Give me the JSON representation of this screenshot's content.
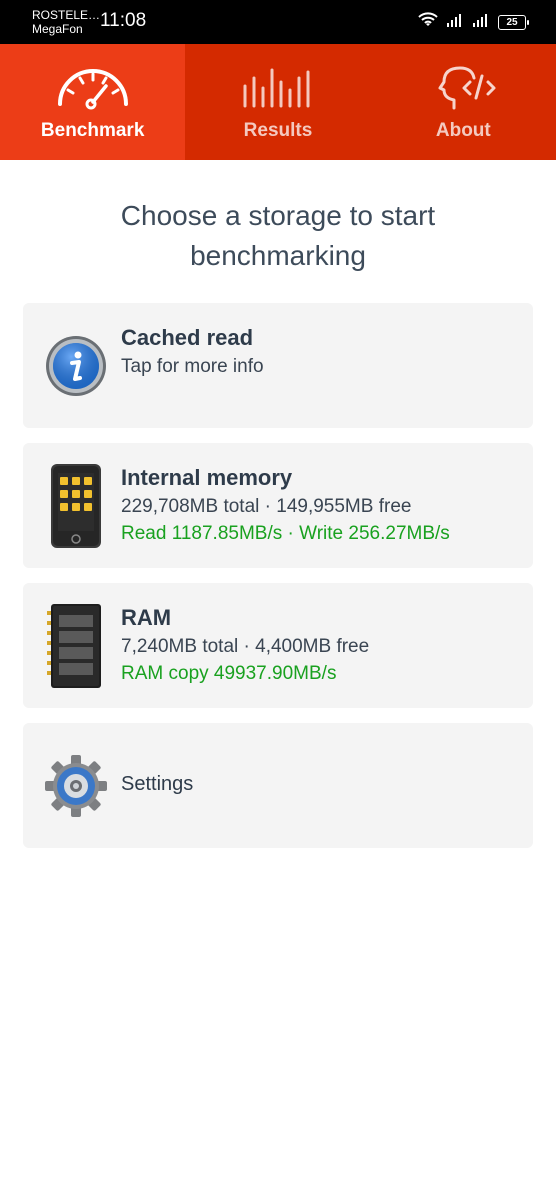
{
  "status_bar": {
    "carrier1": "ROSTELE…",
    "carrier2": "MegaFon",
    "time": "11:08",
    "battery": "25"
  },
  "tabs": [
    {
      "label": "Benchmark",
      "icon": "speedometer-icon",
      "active": true
    },
    {
      "label": "Results",
      "icon": "bars-icon",
      "active": false
    },
    {
      "label": "About",
      "icon": "head-code-icon",
      "active": false
    }
  ],
  "heading": "Choose a storage to start benchmarking",
  "cards": {
    "cached": {
      "title": "Cached read",
      "subtitle": "Tap for more info",
      "icon": "info-icon"
    },
    "internal": {
      "title": "Internal memory",
      "stats": "229,708MB total · 149,955MB free",
      "speed": "Read 1187.85MB/s · Write 256.27MB/s",
      "icon": "phone-icon"
    },
    "ram": {
      "title": "RAM",
      "stats": "7,240MB total · 4,400MB free",
      "speed": "RAM copy 49937.90MB/s",
      "icon": "ram-chip-icon"
    },
    "settings": {
      "label": "Settings",
      "icon": "gear-icon"
    }
  },
  "colors": {
    "accent": "#d42a00",
    "accent_active": "#ec3d17",
    "green": "#19a11f"
  }
}
